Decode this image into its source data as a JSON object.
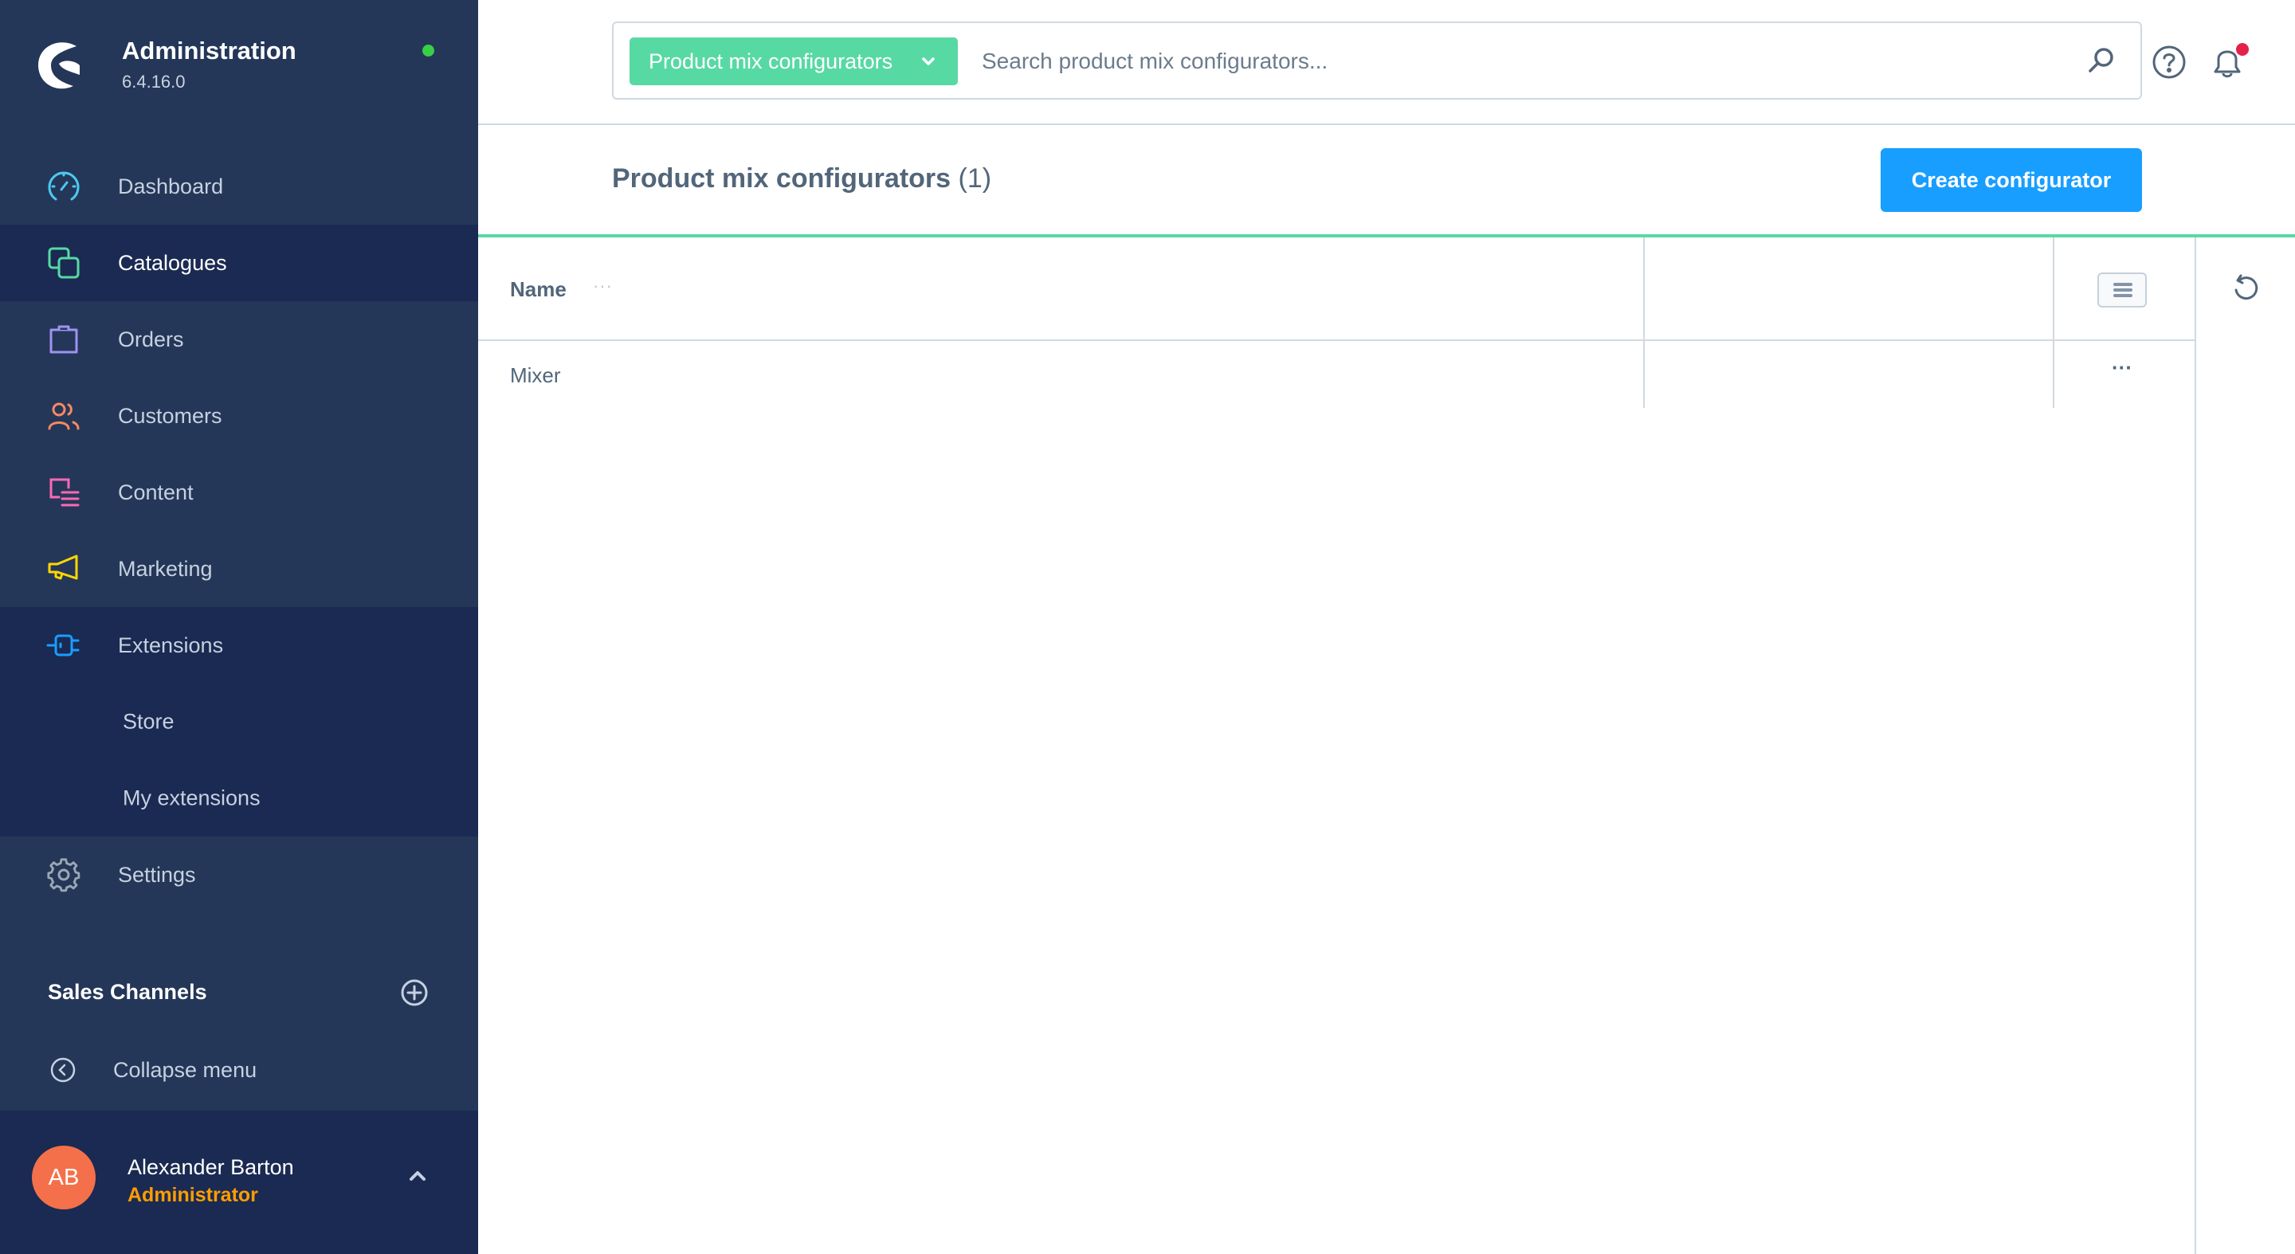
{
  "app": {
    "title": "Administration",
    "version": "6.4.16.0",
    "status_color": "#37d046"
  },
  "sidebar": {
    "items": [
      {
        "id": "dashboard",
        "label": "Dashboard",
        "icon": "dashboard-gauge-icon",
        "color": "#4cc8ef"
      },
      {
        "id": "catalogues",
        "label": "Catalogues",
        "icon": "catalogues-icon",
        "color": "#57d9a3",
        "active": true
      },
      {
        "id": "orders",
        "label": "Orders",
        "icon": "shopping-bag-icon",
        "color": "#a092f0"
      },
      {
        "id": "customers",
        "label": "Customers",
        "icon": "users-icon",
        "color": "#f88962"
      },
      {
        "id": "content",
        "label": "Content",
        "icon": "content-icon",
        "color": "#ff68b4"
      },
      {
        "id": "marketing",
        "label": "Marketing",
        "icon": "megaphone-icon",
        "color": "#ffd700"
      },
      {
        "id": "extensions",
        "label": "Extensions",
        "icon": "plug-icon",
        "color": "#189eff",
        "expanded": true,
        "children": [
          {
            "label": "Store"
          },
          {
            "label": "My extensions"
          }
        ]
      },
      {
        "id": "settings",
        "label": "Settings",
        "icon": "gear-icon",
        "color": "#9aa8b5"
      }
    ],
    "sales_channels_label": "Sales Channels",
    "collapse_label": "Collapse menu",
    "user": {
      "initials": "AB",
      "name": "Alexander Barton",
      "role": "Administrator"
    }
  },
  "topbar": {
    "search_type": "Product mix configurators",
    "search_placeholder": "Search product mix configurators...",
    "search_value": ""
  },
  "page": {
    "title": "Product mix configurators",
    "count": "(1)",
    "create_button": "Create configurator"
  },
  "grid": {
    "columns": [
      {
        "label": "Name",
        "more": "···"
      }
    ],
    "rows": [
      {
        "name": "Mixer",
        "actions": "···"
      }
    ]
  },
  "colors": {
    "sidebar_bg": "#243758",
    "sidebar_active": "#1a2a52",
    "primary": "#189eff",
    "accent_green": "#57d9a3",
    "notification": "#e3224a",
    "role": "#ff9d00",
    "avatar": "#f4704a"
  }
}
